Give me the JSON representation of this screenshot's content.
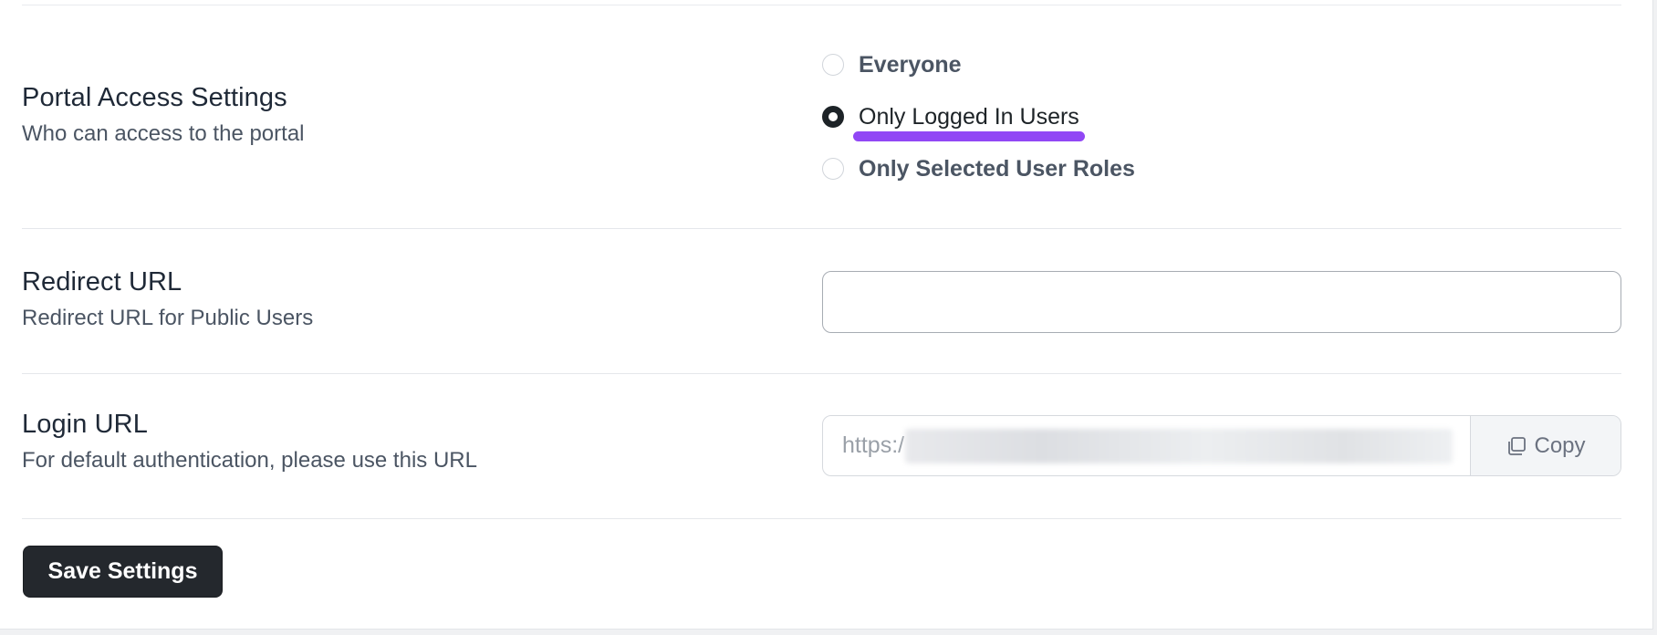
{
  "portal_access": {
    "title": "Portal Access Settings",
    "description": "Who can access to the portal",
    "options": [
      {
        "label": "Everyone",
        "checked": false
      },
      {
        "label": "Only Logged In Users",
        "checked": true
      },
      {
        "label": "Only Selected User Roles",
        "checked": false
      }
    ]
  },
  "redirect": {
    "title": "Redirect URL",
    "description": "Redirect URL for Public Users",
    "value": ""
  },
  "login": {
    "title": "Login URL",
    "description": "For default authentication, please use this URL",
    "url_visible": "https:/",
    "copy_label": "Copy"
  },
  "save_label": "Save Settings",
  "colors": {
    "highlight": "#9147f5",
    "primary_button": "#24282d"
  },
  "icons": {
    "copy": "copy-icon"
  }
}
